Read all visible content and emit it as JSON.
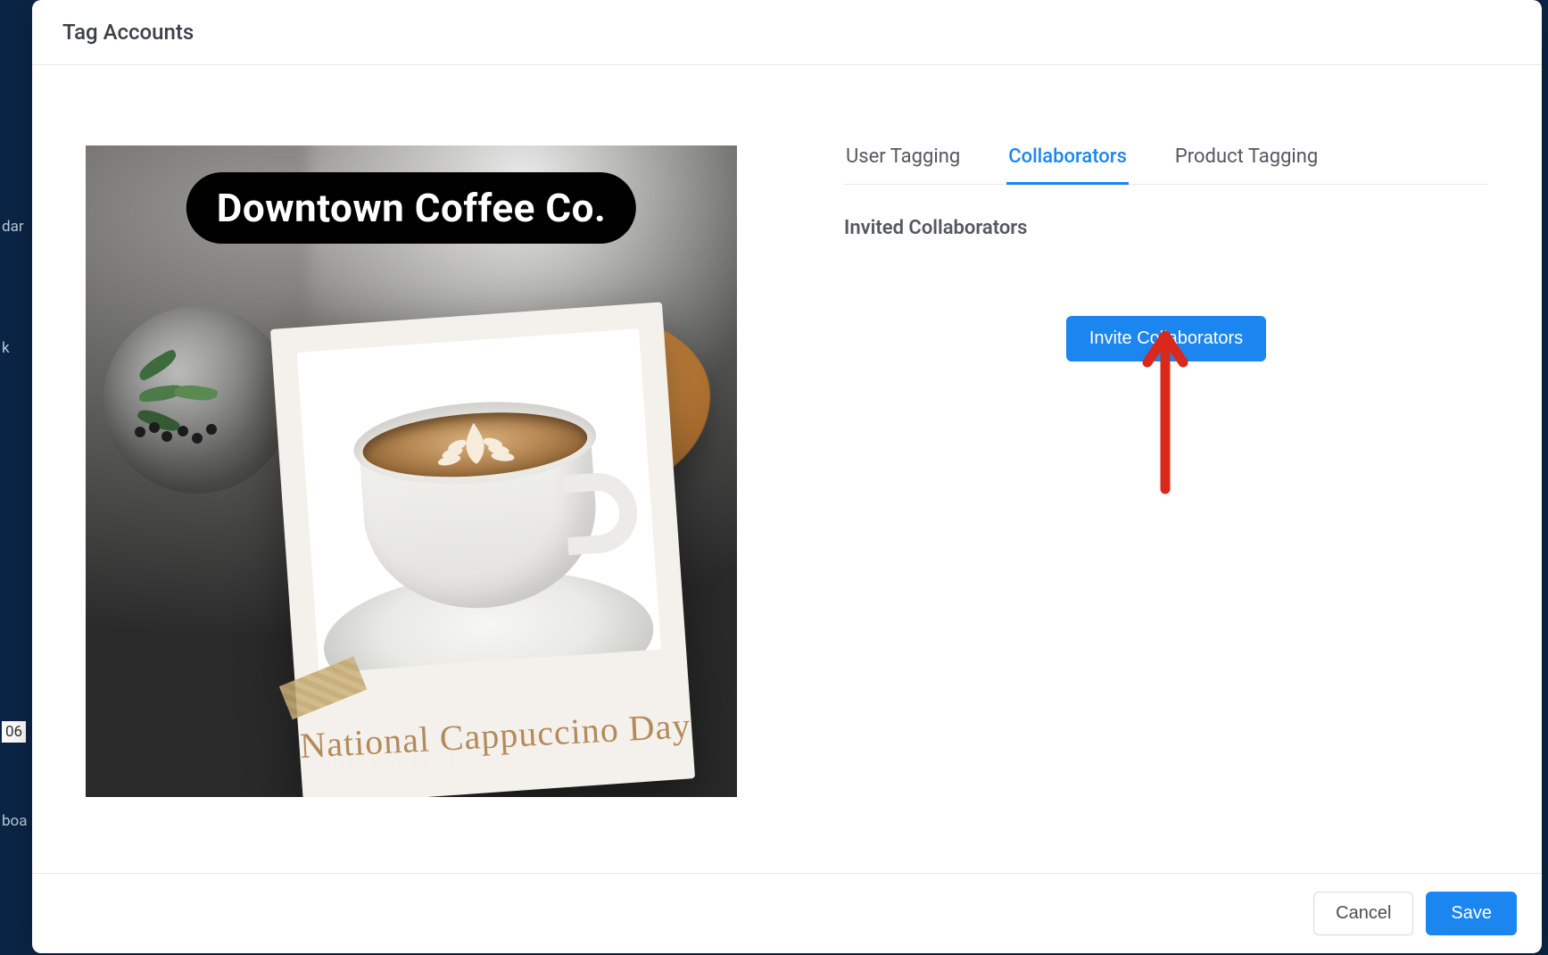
{
  "backdrop": {
    "frag_left_1": "dar",
    "frag_left_2": "k",
    "frag_left_3": "06",
    "frag_left_4": "boa"
  },
  "header": {
    "title": "Tag Accounts"
  },
  "preview": {
    "title_pill": "Downtown Coffee Co.",
    "polaroid_caption": "National Cappuccino Day",
    "address": "101 Water Street"
  },
  "tabs": {
    "items": [
      {
        "label": "User Tagging",
        "active": false
      },
      {
        "label": "Collaborators",
        "active": true
      },
      {
        "label": "Product Tagging",
        "active": false
      }
    ]
  },
  "collaborators": {
    "section_header": "Invited Collaborators",
    "invite_button": "Invite Collaborators"
  },
  "footer": {
    "cancel": "Cancel",
    "save": "Save"
  },
  "annotation": {
    "arrow_color": "#d9281c"
  }
}
